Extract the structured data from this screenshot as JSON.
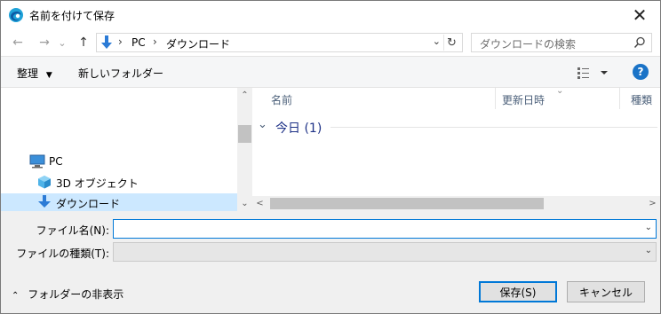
{
  "window": {
    "title": "名前を付けて保存",
    "close_glyph": "✕"
  },
  "nav": {
    "back_glyph": "←",
    "forward_glyph": "→",
    "recent_glyph": "⌄",
    "up_glyph": "↑",
    "breadcrumb_sep": "›",
    "breadcrumb": [
      "PC",
      "ダウンロード"
    ],
    "address_dropdown_glyph": "⌄",
    "refresh_glyph": "↻",
    "search_placeholder": "ダウンロードの検索"
  },
  "toolbar": {
    "organize_label": "整理",
    "organize_caret": "▼",
    "new_folder_label": "新しいフォルダー",
    "help_label": "?"
  },
  "sidebar": {
    "items": [
      {
        "label": "PC",
        "icon": "computer-icon"
      },
      {
        "label": "3D オブジェクト",
        "icon": "3d-objects-icon"
      },
      {
        "label": "ダウンロード",
        "icon": "download-icon",
        "selected": true
      }
    ],
    "scroll_up": "⌃",
    "scroll_down": "⌄"
  },
  "filelist": {
    "columns": [
      "名前",
      "更新日時",
      "種類"
    ],
    "sort_caret": "⌄",
    "groups": [
      {
        "label": "今日 (1)",
        "chevron": "⌄"
      }
    ],
    "scroll_left": "<",
    "scroll_right": ">"
  },
  "form": {
    "filename_label": "ファイル名(N):",
    "filename_value": "",
    "filetype_label": "ファイルの種類(T):",
    "filetype_value": "",
    "dropdown_glyph": "⌄"
  },
  "footer": {
    "hide_folders_chevron": "⌃",
    "hide_folders_label": "フォルダーの非表示",
    "save_label": "保存(S)",
    "cancel_label": "キャンセル"
  },
  "colors": {
    "accent": "#0078d7",
    "selection": "#cce8ff",
    "group_text": "#1e3287",
    "help_bg": "#1a73c7"
  }
}
